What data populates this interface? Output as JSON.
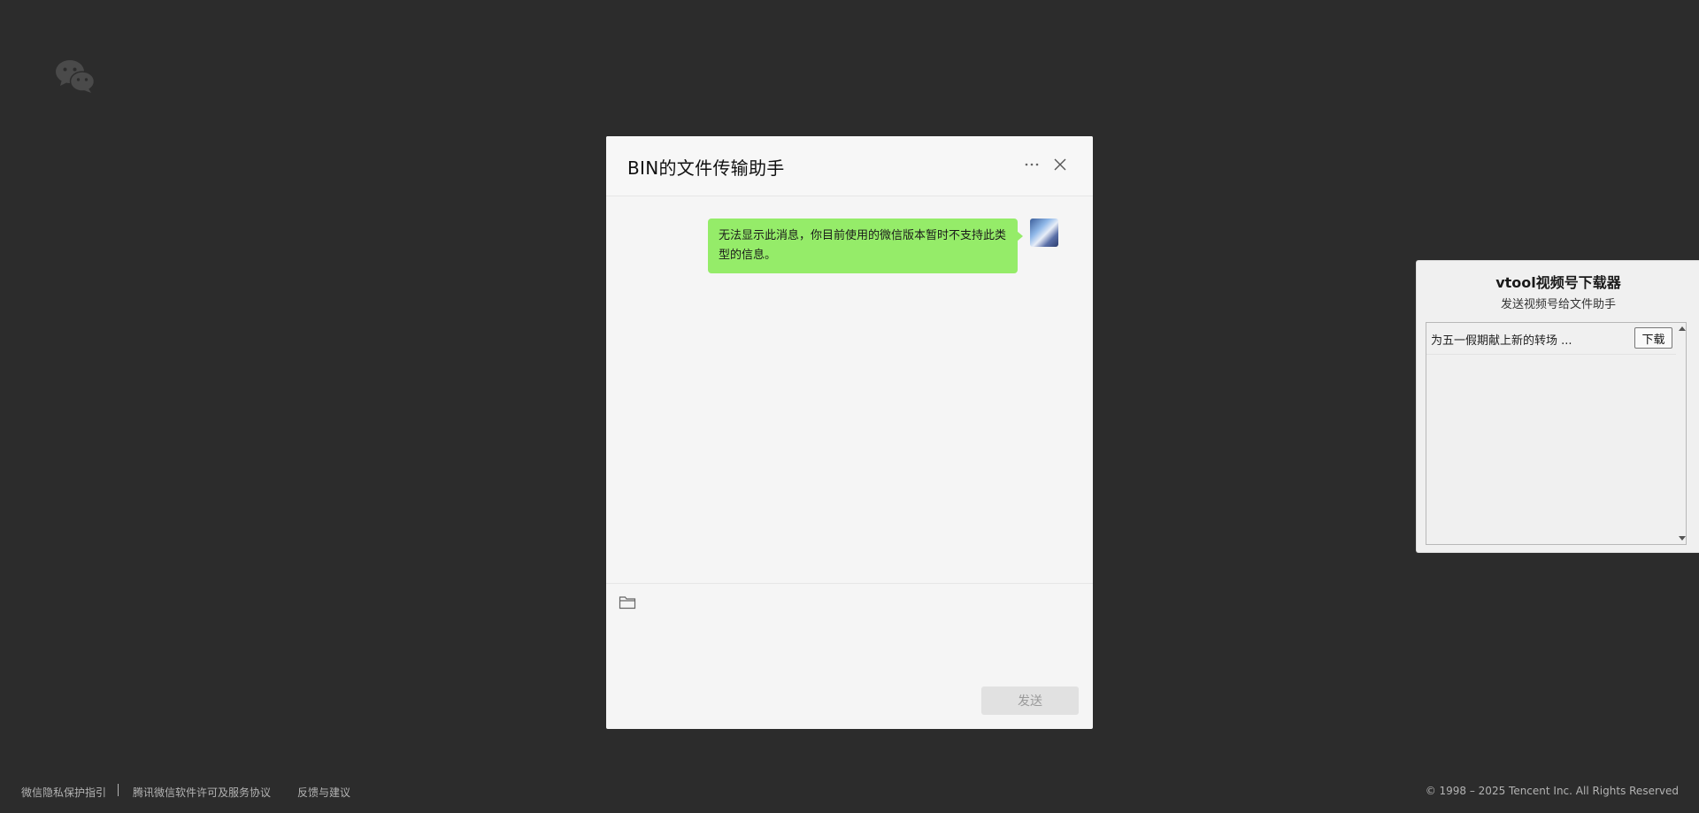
{
  "logo": {
    "icon": "wechat-logo-icon"
  },
  "chat": {
    "title": "BIN的文件传输助手",
    "more_icon": "more-dots-icon",
    "close_icon": "close-icon",
    "messages": [
      {
        "from": "self",
        "text": "无法显示此消息，你目前使用的微信版本暂时不支持此类型的信息。"
      }
    ],
    "composer": {
      "file_icon": "folder-icon",
      "send_label": "发送"
    }
  },
  "vtool": {
    "title": "vtool视频号下载器",
    "subtitle": "发送视频号给文件助手",
    "items": [
      {
        "label": "为五一假期献上新的转场 ...",
        "button": "下载"
      }
    ]
  },
  "footer": {
    "links": [
      "微信隐私保护指引",
      "腾讯微信软件许可及服务协议",
      "反馈与建议"
    ],
    "copyright": "© 1998 – 2025 Tencent Inc. All Rights Reserved"
  },
  "colors": {
    "background": "#2c2c2c",
    "bubble_self": "#95ec69",
    "dialog_bg": "#f5f5f5"
  }
}
